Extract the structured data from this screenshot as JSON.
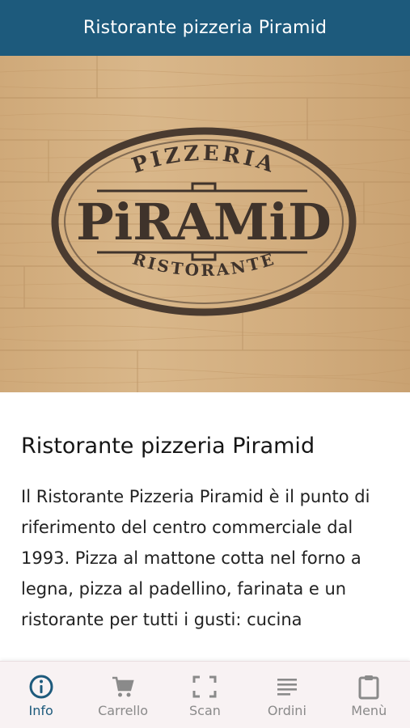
{
  "header": {
    "title": "Ristorante pizzeria Piramid"
  },
  "hero": {
    "logo": {
      "top_text": "PIZZERIA",
      "main_text": "PiRAMiD",
      "bottom_text": "RISTORANTE"
    }
  },
  "content": {
    "title": "Ristorante pizzeria Piramid",
    "body": "Il Ristorante Pizzeria Piramid è il punto di riferimento del centro commerciale dal 1993. Pizza al mattone cotta nel forno a legna, pizza al padellino, farinata e un ristorante per tutti i gusti: cucina"
  },
  "bottom_nav": {
    "items": [
      {
        "label": "Info",
        "icon": "info-icon",
        "active": true
      },
      {
        "label": "Carrello",
        "icon": "cart-icon",
        "active": false
      },
      {
        "label": "Scan",
        "icon": "scan-icon",
        "active": false
      },
      {
        "label": "Ordini",
        "icon": "list-icon",
        "active": false
      },
      {
        "label": "Menù",
        "icon": "clipboard-icon",
        "active": false
      }
    ]
  },
  "colors": {
    "header_bg": "#1d5a7c",
    "accent": "#1d5a7c",
    "inactive": "#8a8a8a",
    "wood": "#d6b285",
    "logo_ink": "#3f332b"
  }
}
